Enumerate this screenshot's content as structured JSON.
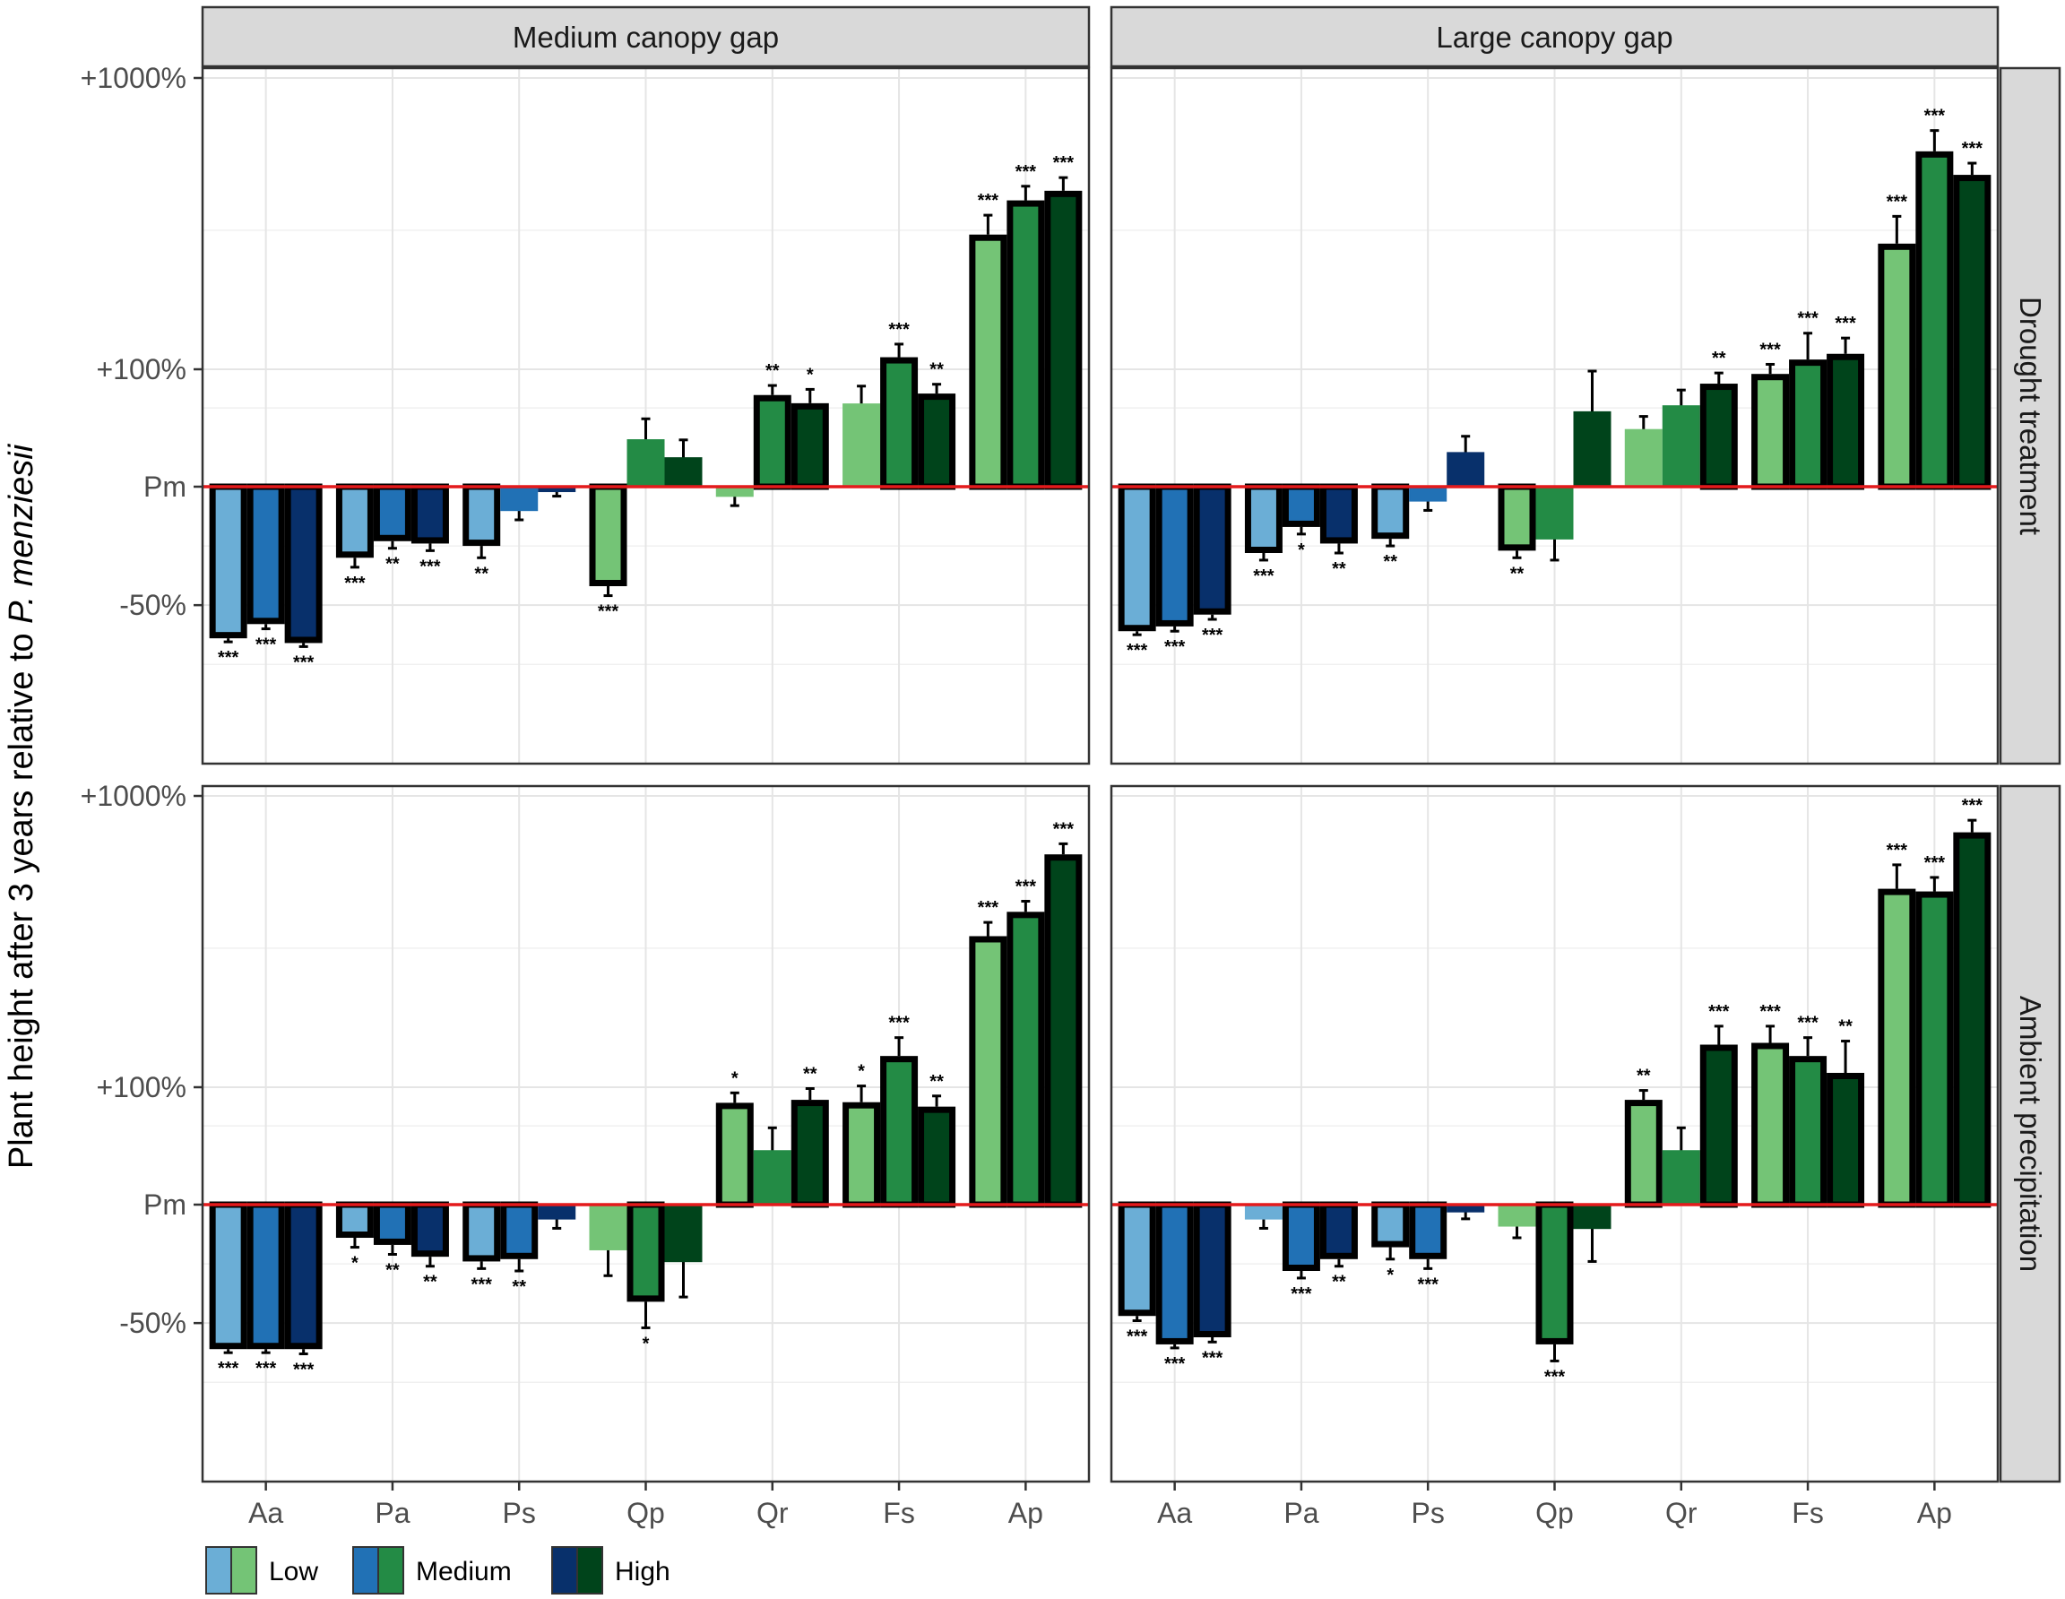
{
  "chart_data": {
    "type": "bar",
    "ylabel_prefix": "Plant height after 3 years relative to",
    "ylabel_species": "P. menziesii",
    "y_ticks": [
      {
        "label": "+1000%",
        "value": 1000
      },
      {
        "label": "+100%",
        "value": 100
      },
      {
        "label": "Pm",
        "value": 0
      },
      {
        "label": "-50%",
        "value": -50
      }
    ],
    "ylim": [
      -85,
      1000
    ],
    "categories": [
      "Aa",
      "Pa",
      "Ps",
      "Qp",
      "Qr",
      "Fs",
      "Ap"
    ],
    "columns": [
      "Medium canopy gap",
      "Large canopy gap"
    ],
    "rows": [
      "Drought treatment",
      "Ambient precipitation"
    ],
    "legend": [
      {
        "label": "Low",
        "blue": "#6baed6",
        "green": "#74c476"
      },
      {
        "label": "Medium",
        "blue": "#2171b5",
        "green": "#238b45"
      },
      {
        "label": "High",
        "blue": "#08306b",
        "green": "#00441b"
      }
    ],
    "colors": {
      "Aa": [
        "#6baed6",
        "#2171b5",
        "#08306b"
      ],
      "Pa": [
        "#6baed6",
        "#2171b5",
        "#08306b"
      ],
      "Ps": [
        "#6baed6",
        "#2171b5",
        "#08306b"
      ],
      "Qp": [
        "#74c476",
        "#238b45",
        "#00441b"
      ],
      "Qr": [
        "#74c476",
        "#238b45",
        "#00441b"
      ],
      "Fs": [
        "#74c476",
        "#238b45",
        "#00441b"
      ],
      "Ap": [
        "#74c476",
        "#238b45",
        "#00441b"
      ],
      "reference_line": "#e41a1c"
    },
    "panels": [
      {
        "row": "Drought treatment",
        "column": "Medium canopy gap",
        "bars": {
          "Aa": [
            {
              "v": -64,
              "e": 1.5,
              "sig": "***"
            },
            {
              "v": -58,
              "e": 2,
              "sig": "***"
            },
            {
              "v": -66,
              "e": 1.5,
              "sig": "***"
            }
          ],
          "Pa": [
            {
              "v": -30,
              "e": 4,
              "sig": "***"
            },
            {
              "v": -23,
              "e": 3,
              "sig": "**"
            },
            {
              "v": -24,
              "e": 3,
              "sig": "***"
            }
          ],
          "Ps": [
            {
              "v": -25,
              "e": 5,
              "sig": "**"
            },
            {
              "v": -10,
              "e": 4,
              "sig": ""
            },
            {
              "v": -2,
              "e": 2,
              "sig": ""
            }
          ],
          "Qp": [
            {
              "v": -42,
              "e": 4,
              "sig": "***"
            },
            {
              "v": 16,
              "e": 14,
              "sig": ""
            },
            {
              "v": 8,
              "e": 8,
              "sig": ""
            }
          ],
          "Qr": [
            {
              "v": -4,
              "e": 4,
              "sig": ""
            },
            {
              "v": 55,
              "e": 14,
              "sig": "**"
            },
            {
              "v": 45,
              "e": 18,
              "sig": "*"
            }
          ],
          "Fs": [
            {
              "v": 44,
              "e": 24,
              "sig": ""
            },
            {
              "v": 110,
              "e": 12,
              "sig": "***"
            },
            {
              "v": 57,
              "e": 14,
              "sig": "**"
            }
          ],
          "Ap": [
            {
              "v": 290,
              "e": 48,
              "sig": "***"
            },
            {
              "v": 380,
              "e": 45,
              "sig": "***"
            },
            {
              "v": 410,
              "e": 45,
              "sig": "***"
            }
          ]
        }
      },
      {
        "row": "Drought treatment",
        "column": "Large canopy gap",
        "bars": {
          "Aa": [
            {
              "v": -61,
              "e": 1.5,
              "sig": "***"
            },
            {
              "v": -59,
              "e": 2,
              "sig": "***"
            },
            {
              "v": -54,
              "e": 2,
              "sig": "***"
            }
          ],
          "Pa": [
            {
              "v": -28,
              "e": 3,
              "sig": "***"
            },
            {
              "v": -17,
              "e": 3,
              "sig": "*"
            },
            {
              "v": -24,
              "e": 4,
              "sig": "**"
            }
          ],
          "Ps": [
            {
              "v": -22,
              "e": 3,
              "sig": "**"
            },
            {
              "v": -6,
              "e": 4,
              "sig": ""
            },
            {
              "v": 10,
              "e": 8,
              "sig": ""
            }
          ],
          "Qp": [
            {
              "v": -27,
              "e": 3,
              "sig": "**"
            },
            {
              "v": -22,
              "e": 9,
              "sig": ""
            },
            {
              "v": 36,
              "e": 60,
              "sig": ""
            }
          ],
          "Qr": [
            {
              "v": 22,
              "e": 10,
              "sig": ""
            },
            {
              "v": 42,
              "e": 20,
              "sig": ""
            },
            {
              "v": 72,
              "e": 20,
              "sig": "**"
            }
          ],
          "Fs": [
            {
              "v": 90,
              "e": 14,
              "sig": "***"
            },
            {
              "v": 108,
              "e": 25,
              "sig": "***"
            },
            {
              "v": 113,
              "e": 15,
              "sig": "***"
            }
          ],
          "Ap": [
            {
              "v": 270,
              "e": 65,
              "sig": "***"
            },
            {
              "v": 560,
              "e": 100,
              "sig": "***"
            },
            {
              "v": 465,
              "e": 45,
              "sig": "***"
            }
          ]
        }
      },
      {
        "row": "Ambient precipitation",
        "column": "Medium canopy gap",
        "bars": {
          "Aa": [
            {
              "v": -61,
              "e": 1.5,
              "sig": "***"
            },
            {
              "v": -61,
              "e": 1.5,
              "sig": "***"
            },
            {
              "v": -61,
              "e": 2,
              "sig": "***"
            }
          ],
          "Pa": [
            {
              "v": -14,
              "e": 4,
              "sig": "*"
            },
            {
              "v": -17,
              "e": 4,
              "sig": "**"
            },
            {
              "v": -22,
              "e": 4,
              "sig": "**"
            }
          ],
          "Ps": [
            {
              "v": -24,
              "e": 3,
              "sig": "***"
            },
            {
              "v": -23,
              "e": 5,
              "sig": "**"
            },
            {
              "v": -6,
              "e": 4,
              "sig": ""
            }
          ],
          "Qp": [
            {
              "v": -19,
              "e": 11,
              "sig": ""
            },
            {
              "v": -41,
              "e": 11,
              "sig": "*"
            },
            {
              "v": -24,
              "e": 15,
              "sig": ""
            }
          ],
          "Qr": [
            {
              "v": 70,
              "e": 18,
              "sig": "*"
            },
            {
              "v": 20,
              "e": 18,
              "sig": ""
            },
            {
              "v": 75,
              "e": 22,
              "sig": "**"
            }
          ],
          "Fs": [
            {
              "v": 71,
              "e": 30,
              "sig": "*"
            },
            {
              "v": 128,
              "e": 20,
              "sig": "***"
            },
            {
              "v": 64,
              "e": 18,
              "sig": "**"
            }
          ],
          "Ap": [
            {
              "v": 330,
              "e": 38,
              "sig": "***"
            },
            {
              "v": 400,
              "e": 35,
              "sig": "***"
            },
            {
              "v": 630,
              "e": 55,
              "sig": "***"
            }
          ]
        }
      },
      {
        "row": "Ambient precipitation",
        "column": "Large canopy gap",
        "bars": {
          "Aa": [
            {
              "v": -47,
              "e": 2,
              "sig": "***"
            },
            {
              "v": -59,
              "e": 1.5,
              "sig": "***"
            },
            {
              "v": -56,
              "e": 2,
              "sig": "***"
            }
          ],
          "Pa": [
            {
              "v": -6,
              "e": 4,
              "sig": ""
            },
            {
              "v": -28,
              "e": 3,
              "sig": "***"
            },
            {
              "v": -23,
              "e": 3,
              "sig": "**"
            }
          ],
          "Ps": [
            {
              "v": -18,
              "e": 5,
              "sig": "*"
            },
            {
              "v": -23,
              "e": 4,
              "sig": "***"
            },
            {
              "v": -3,
              "e": 3,
              "sig": ""
            }
          ],
          "Qp": [
            {
              "v": -9,
              "e": 5,
              "sig": ""
            },
            {
              "v": -59,
              "e": 7,
              "sig": "***"
            },
            {
              "v": -10,
              "e": 14,
              "sig": ""
            }
          ],
          "Qr": [
            {
              "v": 75,
              "e": 18,
              "sig": "**"
            },
            {
              "v": 20,
              "e": 18,
              "sig": ""
            },
            {
              "v": 140,
              "e": 22,
              "sig": "***"
            }
          ],
          "Fs": [
            {
              "v": 142,
              "e": 20,
              "sig": "***"
            },
            {
              "v": 128,
              "e": 20,
              "sig": "***"
            },
            {
              "v": 112,
              "e": 32,
              "sig": "**"
            }
          ],
          "Ap": [
            {
              "v": 480,
              "e": 100,
              "sig": "***"
            },
            {
              "v": 470,
              "e": 55,
              "sig": "***"
            },
            {
              "v": 750,
              "e": 75,
              "sig": "***"
            }
          ]
        }
      }
    ]
  }
}
